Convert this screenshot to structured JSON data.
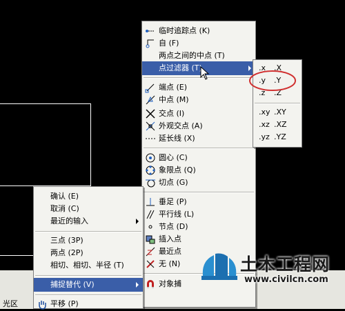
{
  "snap_menu": {
    "items": [
      {
        "label": "临时追踪点 (K)",
        "icon": "temp-track-icon"
      },
      {
        "label": "自 (F)",
        "icon": "from-icon"
      },
      {
        "label": "两点之间的中点 (T)",
        "icon": ""
      },
      {
        "label": "点过滤器 (T)",
        "icon": "",
        "highlighted": true
      },
      {
        "label": "端点 (E)",
        "icon": "endpoint-icon"
      },
      {
        "label": "中点 (M)",
        "icon": "midpoint-icon"
      },
      {
        "label": "交点 (I)",
        "icon": "intersection-icon"
      },
      {
        "label": "外观交点 (A)",
        "icon": "apparent-intersect-icon"
      },
      {
        "label": "延长线 (X)",
        "icon": "extension-icon"
      },
      {
        "label": "圆心 (C)",
        "icon": "center-icon"
      },
      {
        "label": "象限点 (Q)",
        "icon": "quadrant-icon"
      },
      {
        "label": "切点 (G)",
        "icon": "tangent-icon"
      },
      {
        "label": "垂足 (P)",
        "icon": "perpendicular-icon"
      },
      {
        "label": "平行线 (L)",
        "icon": "parallel-icon"
      },
      {
        "label": "节点 (D)",
        "icon": "node-icon"
      },
      {
        "label": "插入点",
        "icon": "insert-icon"
      },
      {
        "label": "最近点",
        "icon": "nearest-icon"
      },
      {
        "label": "无 (N)",
        "icon": "none-icon"
      },
      {
        "label": "对象捕",
        "icon": "osnap-icon"
      }
    ]
  },
  "filter_menu": {
    "items": [
      {
        "a": ".x",
        "b": ".X"
      },
      {
        "a": ".y",
        "b": ".Y"
      },
      {
        "a": ".z",
        "b": ".Z"
      },
      {
        "a": ".xy",
        "b": ".XY"
      },
      {
        "a": ".xz",
        "b": ".XZ"
      },
      {
        "a": ".yz",
        "b": ".YZ"
      }
    ]
  },
  "context_menu": {
    "items": [
      {
        "label": "确认 (E)"
      },
      {
        "label": "取消 (C)"
      },
      {
        "label": "最近的输入"
      },
      {
        "label": "三点 (3P)"
      },
      {
        "label": "两点 (2P)"
      },
      {
        "label": "相切、相切、半径 (T)"
      },
      {
        "label": "捕捉替代 (V)",
        "highlighted": true
      },
      {
        "label": "平移 (P)"
      }
    ],
    "left_fragment": "光区"
  },
  "watermark": {
    "brand": "土木工程网",
    "url": "www.civilcn.com"
  }
}
